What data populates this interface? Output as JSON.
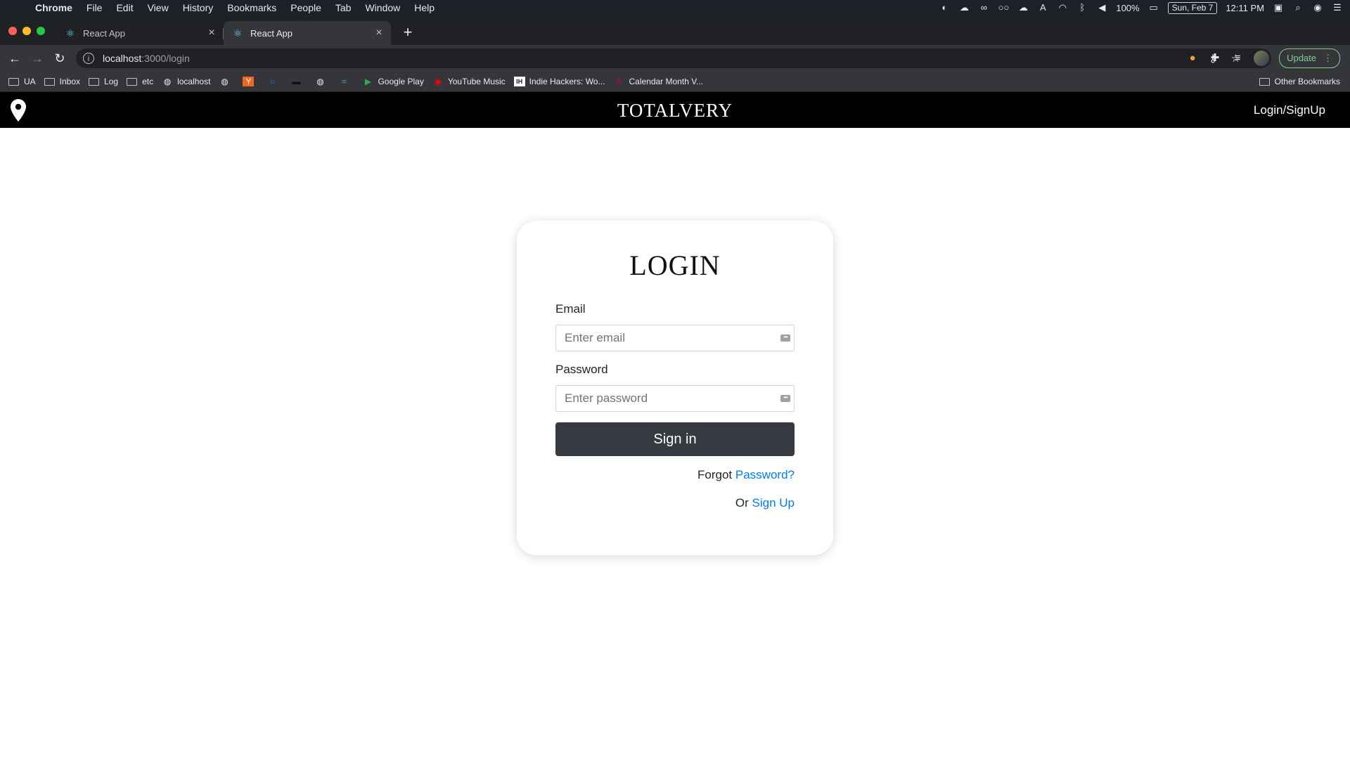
{
  "menubar": {
    "app": "Chrome",
    "items": [
      "File",
      "Edit",
      "View",
      "History",
      "Bookmarks",
      "People",
      "Tab",
      "Window",
      "Help"
    ],
    "battery": "100%",
    "date": "Sun, Feb 7",
    "time": "12:11 PM"
  },
  "tabs": [
    {
      "label": "React App",
      "active": false
    },
    {
      "label": "React App",
      "active": true
    }
  ],
  "omnibox": {
    "host": "localhost",
    "path": ":3000/login"
  },
  "toolbar": {
    "update_label": "Update"
  },
  "bookmarks": [
    {
      "label": "UA",
      "icon": "folder-icon"
    },
    {
      "label": "Inbox",
      "icon": "folder-icon"
    },
    {
      "label": "Log",
      "icon": "folder-icon"
    },
    {
      "label": "etc",
      "icon": "folder-icon"
    },
    {
      "label": "localhost",
      "icon": "globe-icon"
    },
    {
      "label": "",
      "icon": "globe-icon"
    },
    {
      "label": "",
      "icon": "ycombinator-icon"
    },
    {
      "label": "",
      "icon": "ring-icon"
    },
    {
      "label": "",
      "icon": "hat-icon"
    },
    {
      "label": "",
      "icon": "globe-icon"
    },
    {
      "label": "",
      "icon": "wave-icon"
    },
    {
      "label": "Google Play",
      "icon": "play-icon"
    },
    {
      "label": "YouTube Music",
      "icon": "youtube-music-icon"
    },
    {
      "label": "Indie Hackers: Wo...",
      "icon": "ih-icon"
    },
    {
      "label": "Calendar Month V...",
      "icon": "calendar-logo-icon"
    }
  ],
  "bookmarks_other": "Other Bookmarks",
  "app": {
    "brand": "TOTALVERY",
    "nav_link": "Login/SignUp"
  },
  "login": {
    "title": "LOGIN",
    "email_label": "Email",
    "email_placeholder": "Enter email",
    "password_label": "Password",
    "password_placeholder": "Enter password",
    "submit": "Sign in",
    "forgot_prefix": "Forgot",
    "forgot_link": "Password?",
    "or_prefix": "Or",
    "signup_link": "Sign Up"
  },
  "colors": {
    "navbar": "#000000",
    "button": "#343a40",
    "link": "#007bff"
  }
}
